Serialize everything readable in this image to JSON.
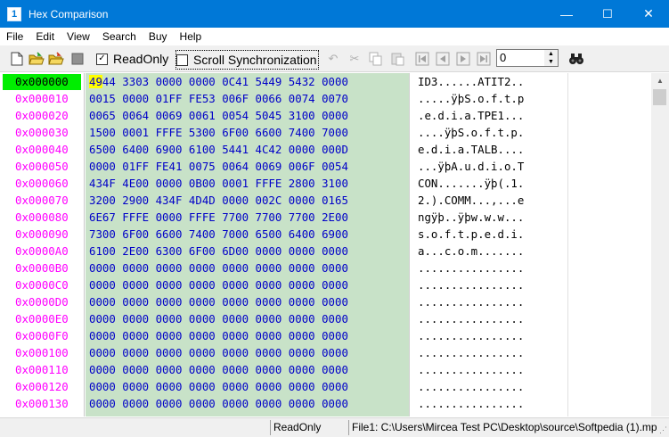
{
  "window": {
    "title": "Hex Comparison",
    "app_icon": "1",
    "minimize": "—",
    "maximize": "☐",
    "close": "✕"
  },
  "menu": [
    "File",
    "Edit",
    "View",
    "Search",
    "Buy",
    "Help"
  ],
  "toolbar": {
    "readonly_label": "ReadOnly",
    "readonly_checked": true,
    "scroll_sync_label": "Scroll Synchronization",
    "scroll_sync_checked": false,
    "offset_value": "0",
    "icons": [
      "new-file-icon",
      "open-folder-icon",
      "open-second-folder-icon",
      "stop-icon",
      "undo-icon",
      "cut-icon",
      "copy-icon",
      "paste-icon",
      "first-difference-icon",
      "previous-difference-icon",
      "next-difference-icon",
      "last-difference-icon",
      "find-binoculars-icon"
    ]
  },
  "rows": [
    {
      "addr": "0x000000",
      "hex": "4944 3303 0000 0000 0C41 5449 5432 0000",
      "ascii": "ID3......ATIT2.."
    },
    {
      "addr": "0x000010",
      "hex": "0015 0000 01FF FE53 006F 0066 0074 0070",
      "ascii": ".....ÿþS.o.f.t.p"
    },
    {
      "addr": "0x000020",
      "hex": "0065 0064 0069 0061 0054 5045 3100 0000",
      "ascii": ".e.d.i.a.TPE1..."
    },
    {
      "addr": "0x000030",
      "hex": "1500 0001 FFFE 5300 6F00 6600 7400 7000",
      "ascii": "....ÿþS.o.f.t.p."
    },
    {
      "addr": "0x000040",
      "hex": "6500 6400 6900 6100 5441 4C42 0000 000D",
      "ascii": "e.d.i.a.TALB...."
    },
    {
      "addr": "0x000050",
      "hex": "0000 01FF FE41 0075 0064 0069 006F 0054",
      "ascii": "...ÿþA.u.d.i.o.T"
    },
    {
      "addr": "0x000060",
      "hex": "434F 4E00 0000 0B00 0001 FFFE 2800 3100",
      "ascii": "CON.......ÿþ(.1."
    },
    {
      "addr": "0x000070",
      "hex": "3200 2900 434F 4D4D 0000 002C 0000 0165",
      "ascii": "2.).COMM...,...e"
    },
    {
      "addr": "0x000080",
      "hex": "6E67 FFFE 0000 FFFE 7700 7700 7700 2E00",
      "ascii": "ngÿþ..ÿþw.w.w..."
    },
    {
      "addr": "0x000090",
      "hex": "7300 6F00 6600 7400 7000 6500 6400 6900",
      "ascii": "s.o.f.t.p.e.d.i."
    },
    {
      "addr": "0x0000A0",
      "hex": "6100 2E00 6300 6F00 6D00 0000 0000 0000",
      "ascii": "a...c.o.m......."
    },
    {
      "addr": "0x0000B0",
      "hex": "0000 0000 0000 0000 0000 0000 0000 0000",
      "ascii": "................"
    },
    {
      "addr": "0x0000C0",
      "hex": "0000 0000 0000 0000 0000 0000 0000 0000",
      "ascii": "................"
    },
    {
      "addr": "0x0000D0",
      "hex": "0000 0000 0000 0000 0000 0000 0000 0000",
      "ascii": "................"
    },
    {
      "addr": "0x0000E0",
      "hex": "0000 0000 0000 0000 0000 0000 0000 0000",
      "ascii": "................"
    },
    {
      "addr": "0x0000F0",
      "hex": "0000 0000 0000 0000 0000 0000 0000 0000",
      "ascii": "................"
    },
    {
      "addr": "0x000100",
      "hex": "0000 0000 0000 0000 0000 0000 0000 0000",
      "ascii": "................"
    },
    {
      "addr": "0x000110",
      "hex": "0000 0000 0000 0000 0000 0000 0000 0000",
      "ascii": "................"
    },
    {
      "addr": "0x000120",
      "hex": "0000 0000 0000 0000 0000 0000 0000 0000",
      "ascii": "................"
    },
    {
      "addr": "0x000130",
      "hex": "0000 0000 0000 0000 0000 0000 0000 0000",
      "ascii": "................"
    }
  ],
  "status": {
    "mode": "ReadOnly",
    "file": "File1: C:\\Users\\Mircea Test PC\\Desktop\\source\\Softpedia (1).mp"
  },
  "colors": {
    "titlebar": "#0078d7",
    "address": "#ff00ff",
    "active_address_bg": "#00ee00",
    "hex_bg": "#c8e2c8",
    "hex_text": "#0000c8",
    "cursor": "#ffff00"
  }
}
